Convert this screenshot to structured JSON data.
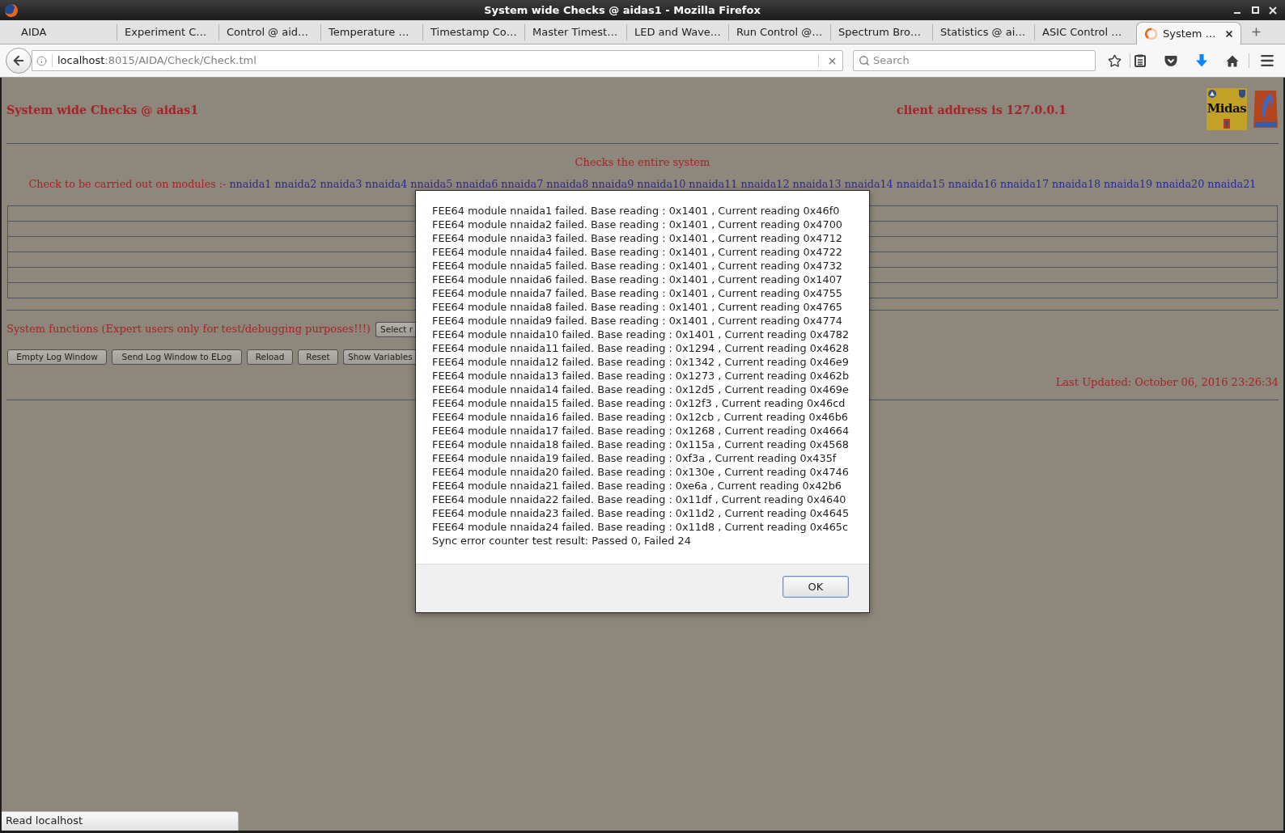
{
  "window": {
    "title": "System wide Checks @ aidas1 - Mozilla Firefox"
  },
  "tabs": [
    {
      "label": "AIDA",
      "selected": false,
      "loading": false
    },
    {
      "label": "Experiment C…",
      "selected": false,
      "loading": false
    },
    {
      "label": "Control @ aid…",
      "selected": false,
      "loading": false
    },
    {
      "label": "Temperature …",
      "selected": false,
      "loading": false
    },
    {
      "label": "Timestamp Co…",
      "selected": false,
      "loading": false
    },
    {
      "label": "Master Timest…",
      "selected": false,
      "loading": false
    },
    {
      "label": "LED and Wave…",
      "selected": false,
      "loading": false
    },
    {
      "label": "Run Control @…",
      "selected": false,
      "loading": false
    },
    {
      "label": "Spectrum Bro…",
      "selected": false,
      "loading": false
    },
    {
      "label": "Statistics @ ai…",
      "selected": false,
      "loading": false
    },
    {
      "label": "ASIC Control …",
      "selected": false,
      "loading": false
    },
    {
      "label": "System …",
      "selected": true,
      "loading": true
    }
  ],
  "toolbar": {
    "url": {
      "host": "localhost",
      "path": ":8015/AIDA/Check/Check.tml"
    },
    "search": {
      "placeholder": "Search"
    }
  },
  "page": {
    "title": "System wide Checks @ aidas1",
    "client_address": "client address is 127.0.0.1",
    "logo_text": "Midas",
    "subtitle": "Checks the entire system",
    "modules_label": "Check to be carried out on modules :-",
    "modules": [
      "nnaida1",
      "nnaida2",
      "nnaida3",
      "nnaida4",
      "nnaida5",
      "nnaida6",
      "nnaida7",
      "nnaida8",
      "nnaida9",
      "nnaida10",
      "nnaida11",
      "nnaida12",
      "nnaida13",
      "nnaida14",
      "nnaida15",
      "nnaida16",
      "nnaida17",
      "nnaida18",
      "nnaida19",
      "nnaida20",
      "nnaida21"
    ],
    "system_functions_label": "System functions (Expert users only for test/debugging purposes!!!)",
    "select": {
      "value": "Select r"
    },
    "buttons": [
      "Empty Log Window",
      "Send Log Window to ELog",
      "Reload",
      "Reset",
      "Show Variables"
    ],
    "last_updated": "Last Updated: October 06, 2016 23:26:34"
  },
  "dialog": {
    "lines": [
      "FEE64 module nnaida1 failed. Base reading : 0x1401 , Current reading 0x46f0",
      "FEE64 module nnaida2 failed. Base reading : 0x1401 , Current reading 0x4700",
      "FEE64 module nnaida3 failed. Base reading : 0x1401 , Current reading 0x4712",
      "FEE64 module nnaida4 failed. Base reading : 0x1401 , Current reading 0x4722",
      "FEE64 module nnaida5 failed. Base reading : 0x1401 , Current reading 0x4732",
      "FEE64 module nnaida6 failed. Base reading : 0x1401 , Current reading 0x1407",
      "FEE64 module nnaida7 failed. Base reading : 0x1401 , Current reading 0x4755",
      "FEE64 module nnaida8 failed. Base reading : 0x1401 , Current reading 0x4765",
      "FEE64 module nnaida9 failed. Base reading : 0x1401 , Current reading 0x4774",
      "FEE64 module nnaida10 failed. Base reading : 0x1401 , Current reading 0x4782",
      "FEE64 module nnaida11 failed. Base reading : 0x1294 , Current reading 0x4628",
      "FEE64 module nnaida12 failed. Base reading : 0x1342 , Current reading 0x46e9",
      "FEE64 module nnaida13 failed. Base reading : 0x1273 , Current reading 0x462b",
      "FEE64 module nnaida14 failed. Base reading : 0x12d5 , Current reading 0x469e",
      "FEE64 module nnaida15 failed. Base reading : 0x12f3 , Current reading 0x46cd",
      "FEE64 module nnaida16 failed. Base reading : 0x12cb , Current reading 0x46b6",
      "FEE64 module nnaida17 failed. Base reading : 0x1268 , Current reading 0x4664",
      "FEE64 module nnaida18 failed. Base reading : 0x115a , Current reading 0x4568",
      "FEE64 module nnaida19 failed. Base reading : 0xf3a , Current reading 0x435f",
      "FEE64 module nnaida20 failed. Base reading : 0x130e , Current reading 0x4746",
      "FEE64 module nnaida21 failed. Base reading : 0xe6a , Current reading 0x42b6",
      "FEE64 module nnaida22 failed. Base reading : 0x11df , Current reading 0x4640",
      "FEE64 module nnaida23 failed. Base reading : 0x11d2 , Current reading 0x4645",
      "FEE64 module nnaida24 failed. Base reading : 0x11d8 , Current reading 0x465c",
      "Sync error counter test result: Passed 0, Failed 24"
    ],
    "buttons": [
      {
        "label": "OK",
        "default": true
      }
    ]
  },
  "status_bar": {
    "text": "Read localhost"
  }
}
